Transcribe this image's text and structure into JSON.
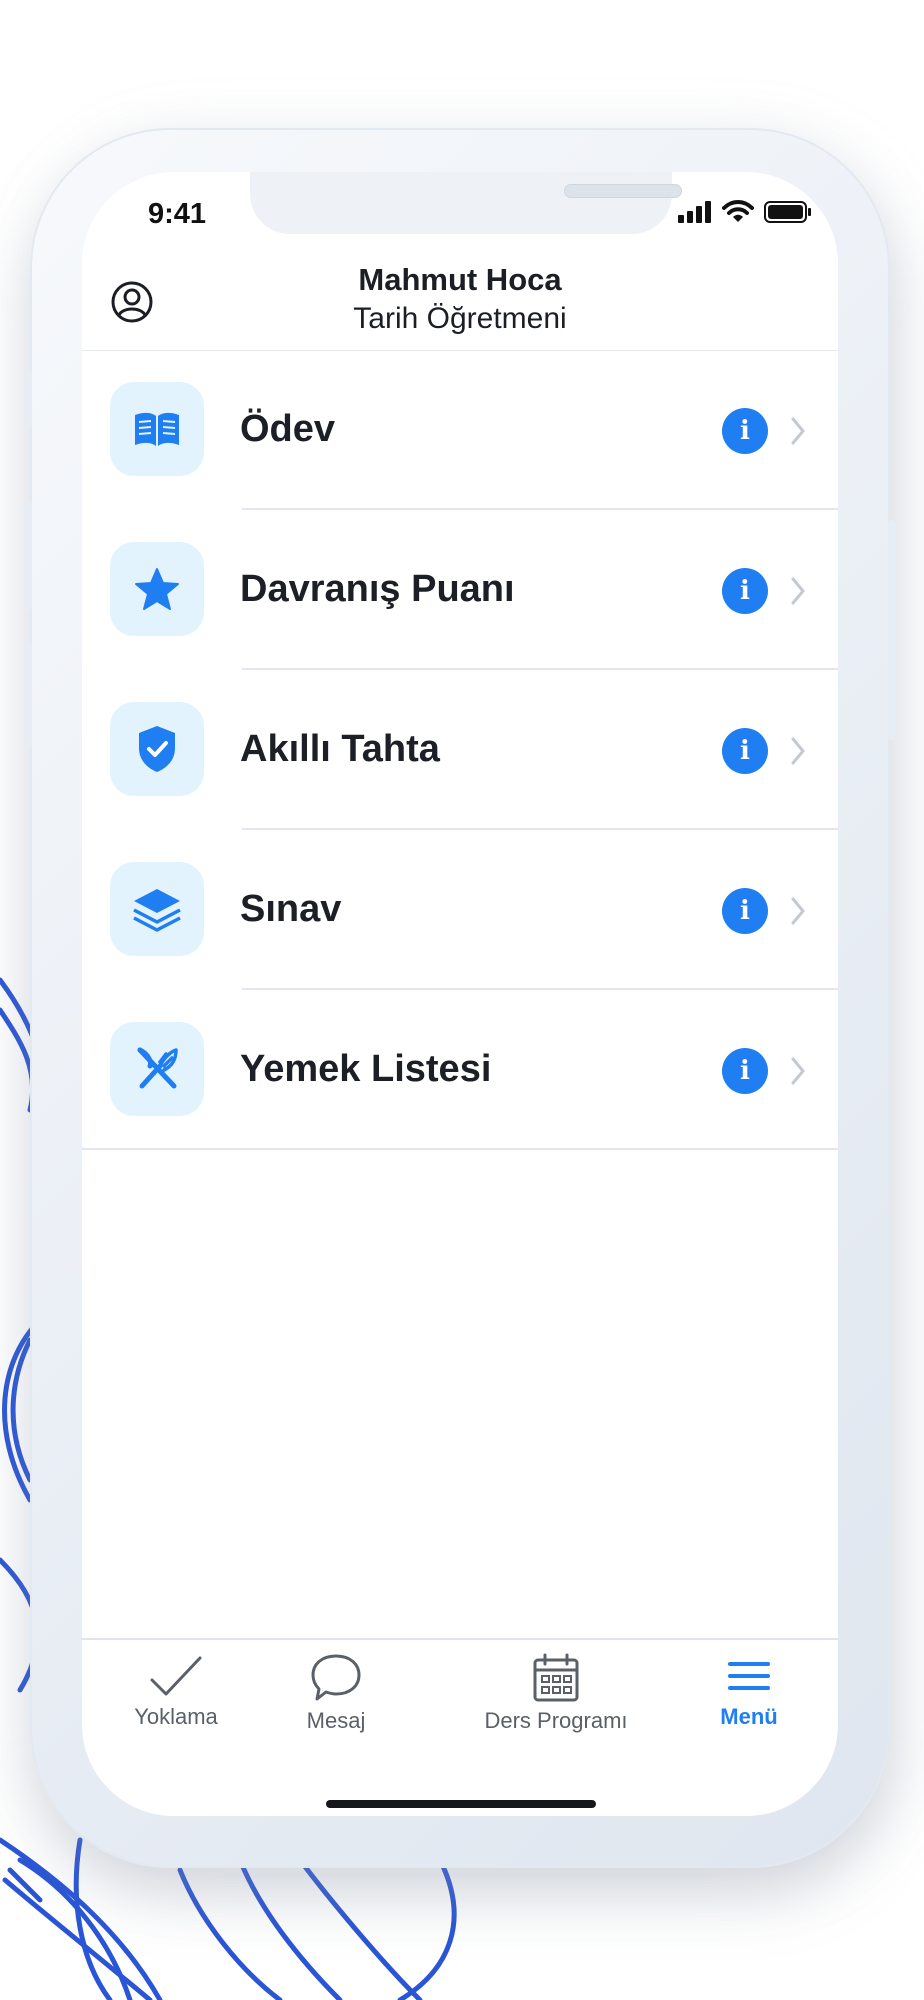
{
  "status_bar": {
    "time": "9:41"
  },
  "header": {
    "name": "Mahmut Hoca",
    "role": "Tarih Öğretmeni"
  },
  "menu_items": [
    {
      "label": "Ödev",
      "icon": "book-icon"
    },
    {
      "label": "Davranış Puanı",
      "icon": "star-icon"
    },
    {
      "label": "Akıllı Tahta",
      "icon": "shield-check-icon"
    },
    {
      "label": "Sınav",
      "icon": "layers-icon"
    },
    {
      "label": "Yemek Listesi",
      "icon": "fork-knife-icon"
    }
  ],
  "info_glyph": "i",
  "tab_bar": {
    "tabs": [
      {
        "label": "Yoklama",
        "icon": "checkmark-icon",
        "active": false
      },
      {
        "label": "Mesaj",
        "icon": "speech-bubble-icon",
        "active": false
      },
      {
        "label": "Ders Programı",
        "icon": "calendar-icon",
        "active": false
      },
      {
        "label": "Menü",
        "icon": "hamburger-menu-icon",
        "active": true
      }
    ]
  },
  "colors": {
    "accent": "#1f7ef1",
    "icon_tile_bg": "#e3f3fd",
    "doodle": "#2a55d6",
    "text": "#1c1f25"
  }
}
